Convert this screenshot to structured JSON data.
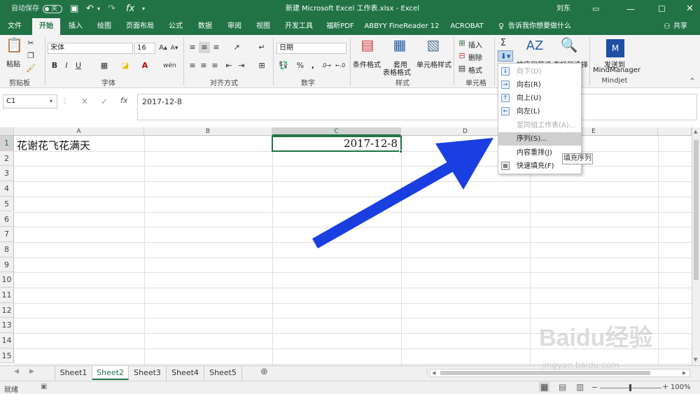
{
  "titlebar": {
    "autosave": "自动保存",
    "autosave_state": "关",
    "title": "新建 Microsoft Excel 工作表.xlsx  -  Excel",
    "user": "刘东"
  },
  "tabs": [
    "文件",
    "开始",
    "插入",
    "绘图",
    "页面布局",
    "公式",
    "数据",
    "审阅",
    "视图",
    "开发工具",
    "福昕PDF",
    "ABBYY FineReader 12",
    "ACROBAT"
  ],
  "tell_me": "告诉我你想要做什么",
  "share": "共享",
  "ribbon": {
    "clipboard": {
      "paste": "粘贴",
      "group": "剪贴板"
    },
    "font": {
      "name": "宋体",
      "size": "16",
      "group": "字体",
      "bold": "B",
      "italic": "I",
      "underline": "U"
    },
    "alignment": {
      "group": "对齐方式"
    },
    "number": {
      "format": "日期",
      "group": "数字",
      "percent": "%"
    },
    "styles": {
      "conditional": "条件格式",
      "table_line1": "套用",
      "table_line2": "表格格式",
      "cell_styles": "单元格样式",
      "group": "样式"
    },
    "cells": {
      "insert": "插入",
      "delete": "删除",
      "format": "格式",
      "group": "单元格"
    },
    "editing": {
      "sort_filter": "排序和筛选",
      "find_select": "查找和选择"
    },
    "mindjet": {
      "send_line1": "发送到",
      "send_line2": "MindManager",
      "group": "Mindjet"
    }
  },
  "formula_bar": {
    "name_box": "C1",
    "fx": "fx",
    "value": "2017-12-8"
  },
  "columns": [
    "A",
    "B",
    "C",
    "D",
    "E"
  ],
  "rows": [
    "1",
    "2",
    "3",
    "4",
    "5",
    "6",
    "7",
    "8",
    "9",
    "10",
    "11",
    "12",
    "13",
    "14",
    "15"
  ],
  "cells": {
    "A1": "花谢花飞花满天",
    "C1": "2017-12-8"
  },
  "fill_menu": {
    "items": [
      {
        "label": "向下(D)",
        "icon": "↓",
        "disabled": true
      },
      {
        "label": "向右(R)",
        "icon": "→",
        "disabled": false
      },
      {
        "label": "向上(U)",
        "icon": "↑",
        "disabled": false
      },
      {
        "label": "向左(L)",
        "icon": "←",
        "disabled": false
      },
      {
        "label": "至同组工作表(A)...",
        "icon": "",
        "disabled": true
      },
      {
        "label": "序列(S)...",
        "icon": "",
        "disabled": false,
        "highlighted": true
      },
      {
        "label": "内容重排(J)",
        "icon": "",
        "disabled": false
      },
      {
        "label": "快速填充(F)",
        "icon": "▦",
        "disabled": false
      }
    ],
    "tooltip": "填充序列"
  },
  "sheets": [
    "Sheet1",
    "Sheet2",
    "Sheet3",
    "Sheet4",
    "Sheet5"
  ],
  "active_sheet": "Sheet2",
  "status": {
    "mode": "就绪",
    "zoom": "100%"
  },
  "watermark": {
    "brand": "Baidu经验",
    "url": "jingyan.baidu.com"
  },
  "colors": {
    "excel_green": "#217346",
    "arrow_blue": "#1a3fe0",
    "selection": "#217346"
  }
}
